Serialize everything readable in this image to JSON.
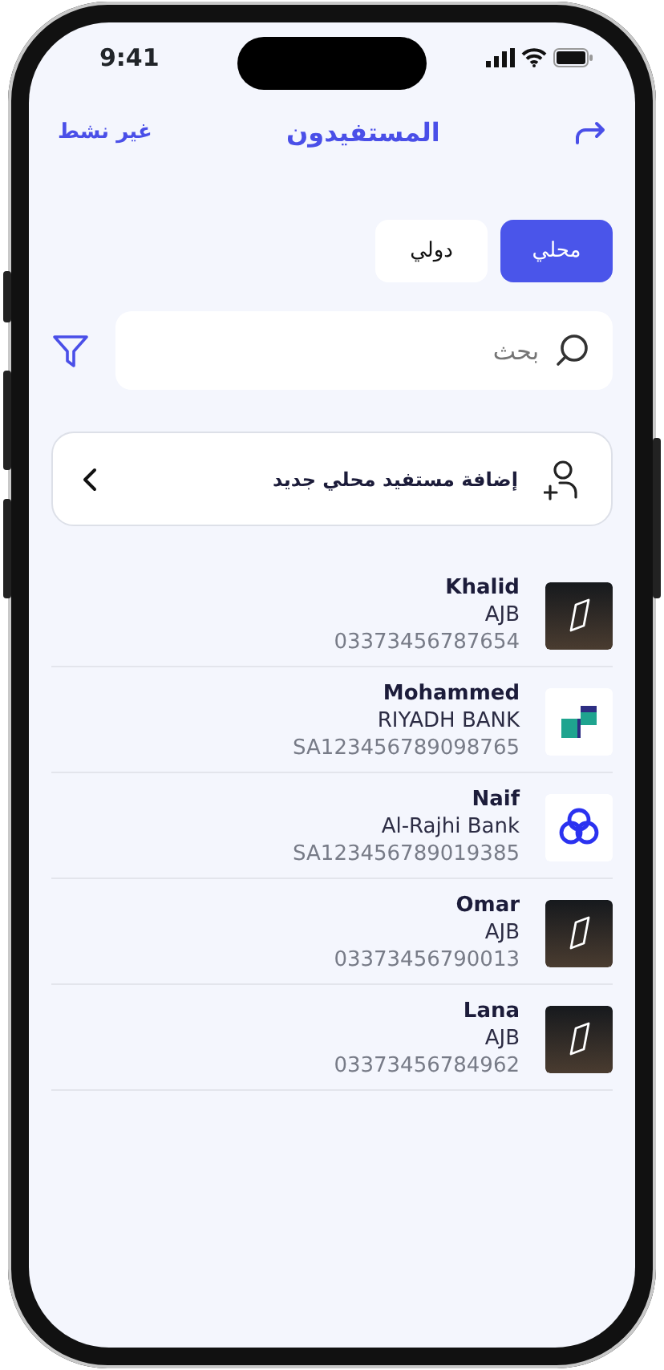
{
  "status_bar": {
    "time": "9:41"
  },
  "header": {
    "title": "المستفيدون",
    "action": "غير نشط"
  },
  "tabs": [
    {
      "label": "محلي",
      "selected": true
    },
    {
      "label": "دولي",
      "selected": false
    }
  ],
  "search": {
    "placeholder": "بحث"
  },
  "add_button": {
    "label": "إضافة مستفيد محلي جديد"
  },
  "beneficiaries": [
    {
      "name": "Khalid",
      "bank": "AJB",
      "account": "03373456787654",
      "kind": "ajb"
    },
    {
      "name": "Mohammed",
      "bank": "RIYADH BANK",
      "account": "SA123456789098765",
      "kind": "riyad"
    },
    {
      "name": "Naif",
      "bank": "Al-Rajhi Bank",
      "account": "SA123456789019385",
      "kind": "rajhi"
    },
    {
      "name": "Omar",
      "bank": "AJB",
      "account": "03373456790013",
      "kind": "ajb"
    },
    {
      "name": "Lana",
      "bank": "AJB",
      "account": "03373456784962",
      "kind": "ajb"
    }
  ]
}
